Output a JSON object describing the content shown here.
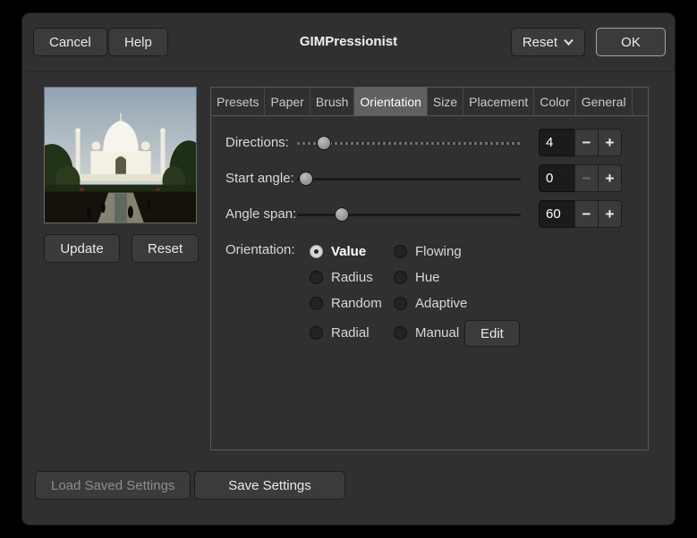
{
  "window": {
    "title": "GIMPressionist",
    "buttons": {
      "cancel": "Cancel",
      "help": "Help",
      "reset": "Reset",
      "ok": "OK"
    }
  },
  "icons": {
    "minus": "−",
    "plus": "+",
    "chevron_down": "chevron-down"
  },
  "preview": {
    "update_label": "Update",
    "reset_label": "Reset"
  },
  "tabs": [
    {
      "label": "Presets",
      "active": false
    },
    {
      "label": "Paper",
      "active": false
    },
    {
      "label": "Brush",
      "active": false
    },
    {
      "label": "Orientation",
      "active": true
    },
    {
      "label": "Size",
      "active": false
    },
    {
      "label": "Placement",
      "active": false
    },
    {
      "label": "Color",
      "active": false
    },
    {
      "label": "General",
      "active": false
    }
  ],
  "controls": {
    "directions": {
      "label": "Directions:",
      "value": "4"
    },
    "start_angle": {
      "label": "Start angle:",
      "value": "0"
    },
    "angle_span": {
      "label": "Angle span:",
      "value": "60"
    },
    "orientation": {
      "label": "Orientation:",
      "options": [
        "Value",
        "Flowing",
        "Radius",
        "Hue",
        "Random",
        "Adaptive",
        "Radial",
        "Manual"
      ],
      "selected": "Value",
      "edit_label": "Edit"
    }
  },
  "footer": {
    "load_label": "Load Saved Settings",
    "save_label": "Save Settings"
  }
}
